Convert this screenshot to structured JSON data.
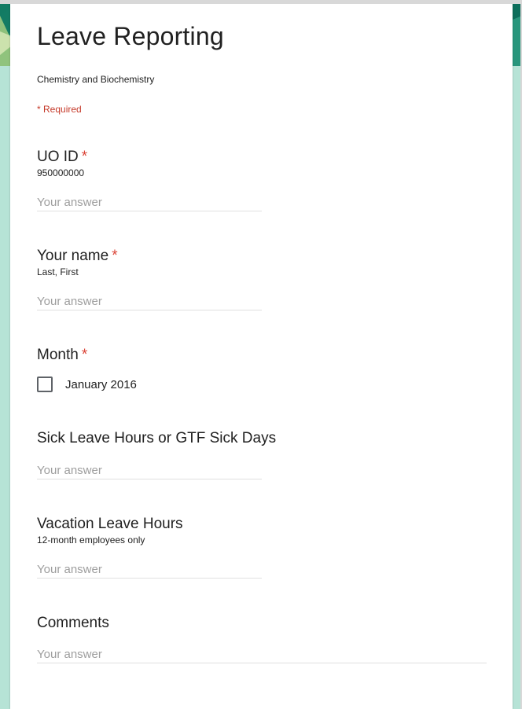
{
  "form": {
    "title": "Leave Reporting",
    "description": "Chemistry and Biochemistry",
    "required_note": "* Required"
  },
  "questions": [
    {
      "title": "UO ID",
      "required_marker": "*",
      "help": "950000000",
      "placeholder": "Your answer"
    },
    {
      "title": "Your name",
      "required_marker": "*",
      "help": "Last, First",
      "placeholder": "Your answer"
    },
    {
      "title": "Month",
      "required_marker": "*",
      "options": [
        "January 2016"
      ]
    },
    {
      "title": "Sick Leave Hours or GTF Sick Days",
      "placeholder": "Your answer"
    },
    {
      "title": "Vacation Leave Hours",
      "help": "12-month employees only",
      "placeholder": "Your answer"
    },
    {
      "title": "Comments",
      "placeholder": "Your answer"
    }
  ],
  "colors": {
    "background": "#b6e3d6",
    "required": "#db4437",
    "card": "#ffffff"
  }
}
